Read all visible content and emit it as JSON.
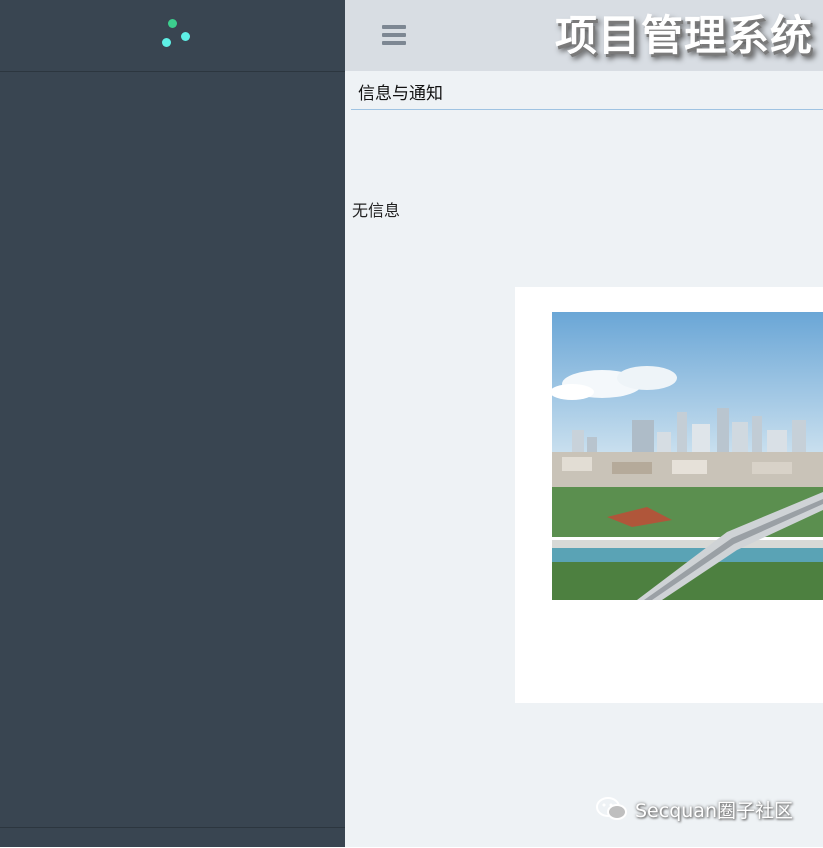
{
  "header": {
    "app_title": "项目管理系统"
  },
  "panel": {
    "title": "信息与通知",
    "empty_message": "无信息"
  },
  "watermark": {
    "text": "Secquan圈子社区"
  },
  "colors": {
    "sidebar_bg": "#394551",
    "main_bg": "#eef2f5",
    "topbar_bg": "#d8dde3",
    "logo_dot_green": "#3ccf8e",
    "logo_dot_cyan": "#5ef0e6",
    "panel_underline": "#9fc3e2"
  },
  "icons": {
    "sidebar_logo": "three-dot-logo-icon",
    "menu_toggle": "hamburger-menu-icon",
    "watermark": "wechat-icon"
  }
}
